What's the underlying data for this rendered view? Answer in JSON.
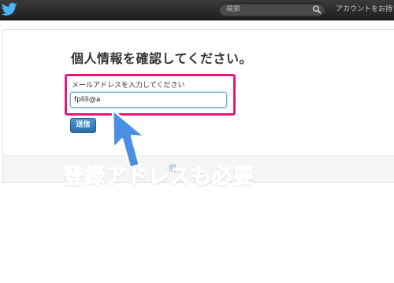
{
  "header": {
    "logo_icon": "twitter-bird-icon",
    "search_placeholder": "検索",
    "search_icon": "magnifier-icon",
    "account_link": "アカウントをお持ち"
  },
  "form": {
    "heading": "個人情報を確認してください。",
    "email_label": "メールアドレスを入力してください",
    "email_value": "fplili@a",
    "submit_label": "送信"
  },
  "footer": {
    "partial_text": "問"
  },
  "annotation": {
    "caption": "登録アドレスも必要",
    "arrow_icon": "arrow-up-icon",
    "highlight_color": "#e5197d",
    "caption_color": "#4a90e2"
  },
  "colors": {
    "topbar": "#2b2b2b",
    "button": "#2f78b7"
  }
}
